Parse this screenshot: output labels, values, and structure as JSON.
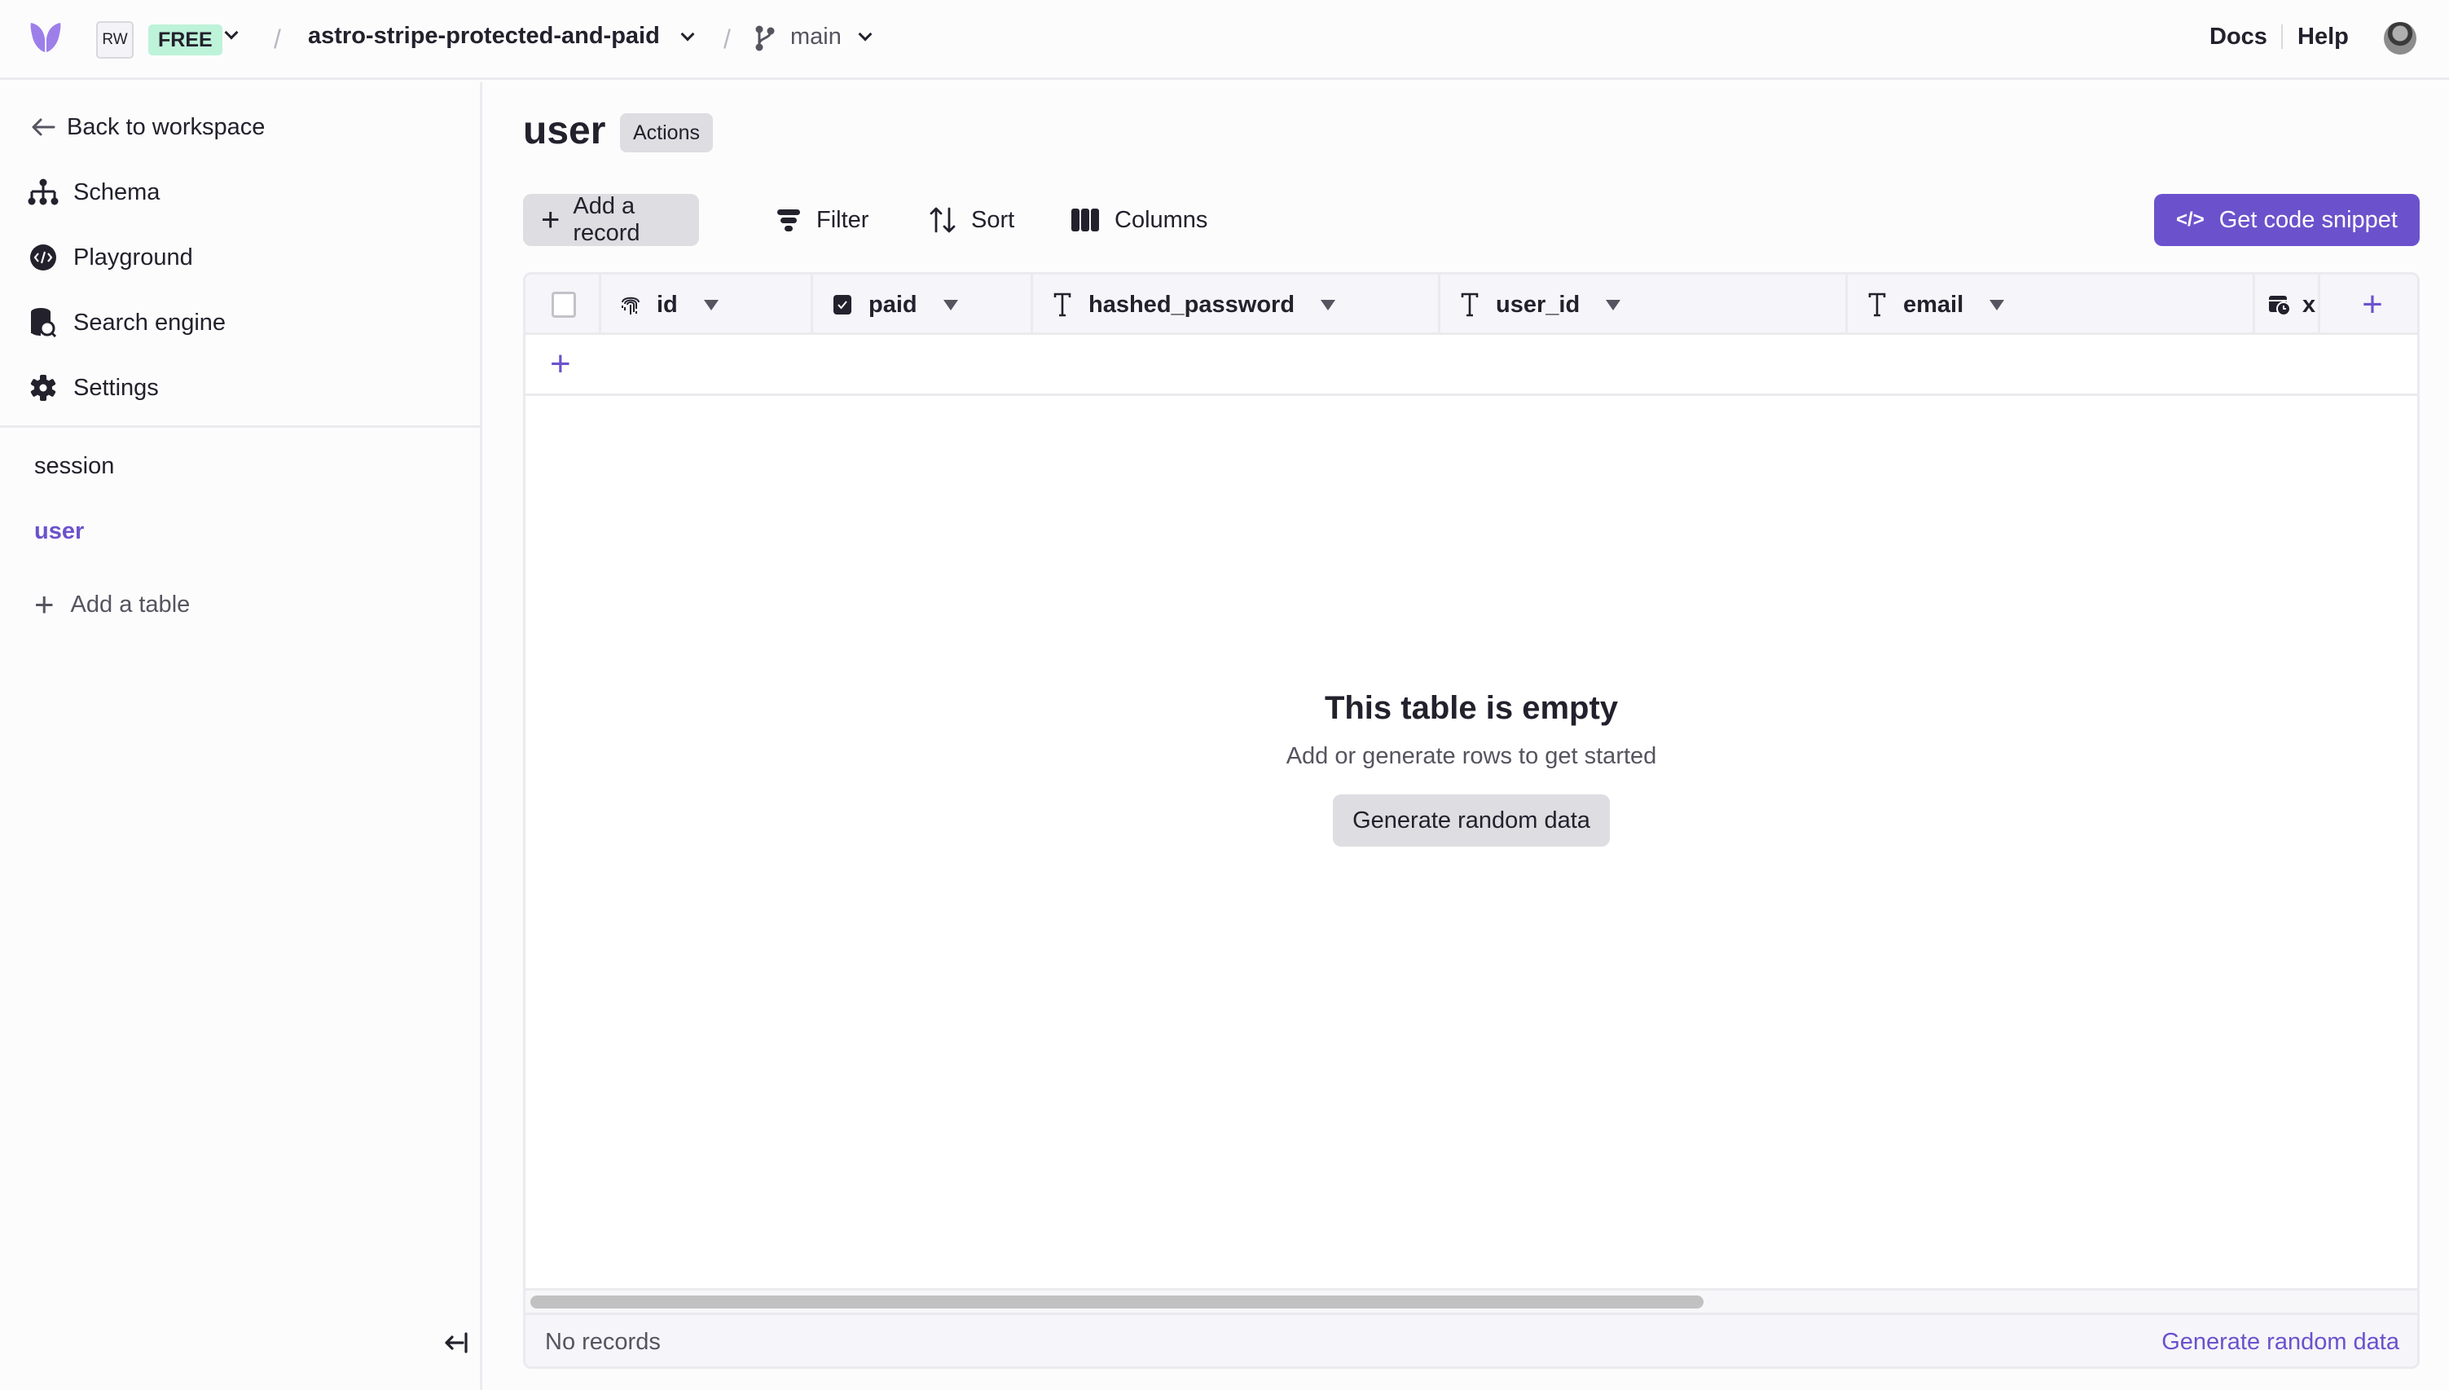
{
  "topbar": {
    "logo": "butterfly-logo-icon",
    "workspace_badge": "RW",
    "plan_badge": "FREE",
    "separator": "/",
    "database_name": "astro-stripe-protected-and-paid",
    "branch_name": "main",
    "docs_label": "Docs",
    "help_label": "Help",
    "colors": {
      "plan_badge_bg": "#bdf3d9",
      "logo": "#9d7fea"
    }
  },
  "sidebar": {
    "back_label": "Back to workspace",
    "nav": [
      {
        "label": "Schema",
        "icon": "schema-icon"
      },
      {
        "label": "Playground",
        "icon": "playground-icon"
      },
      {
        "label": "Search engine",
        "icon": "search-engine-icon"
      },
      {
        "label": "Settings",
        "icon": "settings-icon"
      }
    ],
    "tables": [
      {
        "label": "session",
        "active": false
      },
      {
        "label": "user",
        "active": true
      }
    ],
    "add_table_label": "Add a table"
  },
  "main": {
    "title": "user",
    "actions_label": "Actions",
    "toolbar": {
      "add_record": "Add a record",
      "filter": "Filter",
      "sort": "Sort",
      "columns": "Columns",
      "get_code_snippet": "Get code snippet"
    },
    "grid": {
      "columns": [
        {
          "name": "id",
          "icon": "fingerprint-icon"
        },
        {
          "name": "paid",
          "icon": "boolean-checkbox-icon"
        },
        {
          "name": "hashed_password",
          "icon": "text-type-icon"
        },
        {
          "name": "user_id",
          "icon": "text-type-icon"
        },
        {
          "name": "email",
          "icon": "text-type-icon"
        },
        {
          "name": "x",
          "icon": "datetime-icon"
        }
      ],
      "empty_title": "This table is empty",
      "empty_subtitle": "Add or generate rows to get started",
      "generate_button": "Generate random data",
      "footer_status": "No records",
      "footer_generate_link": "Generate random data"
    },
    "colors": {
      "accent": "#6b52cc"
    }
  }
}
